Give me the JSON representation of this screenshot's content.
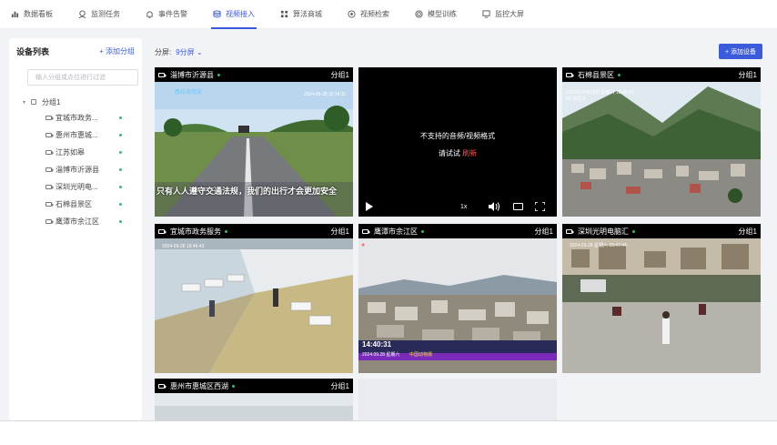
{
  "nav": {
    "items": [
      {
        "label": "数据看板",
        "icon": "bar-chart-icon"
      },
      {
        "label": "监测任务",
        "icon": "task-icon"
      },
      {
        "label": "事件告警",
        "icon": "bell-icon"
      },
      {
        "label": "视频接入",
        "icon": "database-icon"
      },
      {
        "label": "算法商城",
        "icon": "grid-icon"
      },
      {
        "label": "视频检索",
        "icon": "target-icon"
      },
      {
        "label": "模型训练",
        "icon": "model-icon"
      },
      {
        "label": "监控大屏",
        "icon": "monitor-icon"
      }
    ],
    "active_index": 3,
    "accent": "#3b5bdb"
  },
  "sidebar": {
    "title": "设备列表",
    "add_group": "+ 添加分组",
    "search_placeholder": "输入分组或点位进行过滤",
    "group": {
      "label": "分组1"
    },
    "items": [
      {
        "label": "宜城市政务..."
      },
      {
        "label": "惠州市惠城..."
      },
      {
        "label": "江苏如皋"
      },
      {
        "label": "淄博市沂源县"
      },
      {
        "label": "深圳光明电..."
      },
      {
        "label": "石棉县景区"
      },
      {
        "label": "鹰潭市余江区"
      }
    ],
    "online_color": "#2fbf6e"
  },
  "toolbar": {
    "split_label": "分屏:",
    "split_value": "9分屏 ⌄",
    "add_device": "+ 添加设备"
  },
  "tiles": [
    {
      "name": "淄博市沂源县",
      "group": "分组1",
      "banner": "感坊谈驾安",
      "timestamp": "2024-09-28 16:14:11",
      "overlay": "只有人人遵守交通法规，我们的出行才会更加安全"
    },
    {
      "name": "",
      "group": "",
      "message": "不支持的音频/视频格式",
      "retry_text": "请试试",
      "retry_link": "刷新",
      "speed": "1x"
    },
    {
      "name": "石棉县景区",
      "group": "分组1",
      "timestamp": "2024年09月28日 星期六 16:46:53",
      "stamp_sub": "A2 景区北"
    },
    {
      "name": "宜城市政务服务",
      "group": "分组1",
      "timestamp": "2024-09-28 16:46:43"
    },
    {
      "name": "鹰潭市余江区",
      "group": "分组1",
      "time_big": "14:40:31",
      "date_small": "2024.09.28 星期六",
      "tag": "中国动物摄"
    },
    {
      "name": "深圳光明电脑汇",
      "group": "分组1",
      "timestamp": "2024-09-28 星期六 15:47:44"
    },
    {
      "name": "惠州市惠城区西湖",
      "group": "分组1"
    }
  ]
}
